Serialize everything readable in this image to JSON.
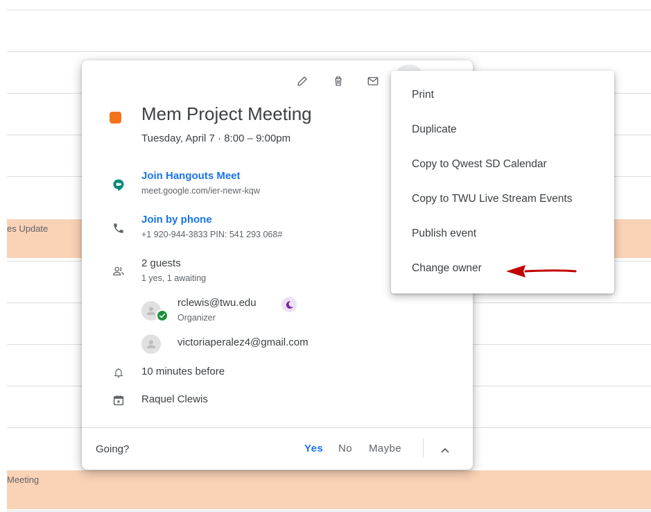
{
  "background": {
    "events": [
      {
        "label": "es Update"
      },
      {
        "label": "Meeting"
      }
    ]
  },
  "event": {
    "color": "#f4711c",
    "title": "Mem Project Meeting",
    "datetime": "Tuesday, April 7  ·  8:00 – 9:00pm",
    "hangouts": {
      "link_label": "Join Hangouts Meet",
      "url": "meet.google.com/ier-newr-kqw"
    },
    "phone": {
      "link_label": "Join by phone",
      "details": "+1 920-944-3833 PIN: 541 293 068#"
    },
    "guests": {
      "count_label": "2 guests",
      "status": "1 yes, 1 awaiting",
      "list": [
        {
          "email": "rclewis@twu.edu",
          "role": "Organizer"
        },
        {
          "email": "victoriaperalez4@gmail.com"
        }
      ]
    },
    "reminder": "10 minutes before",
    "calendar_owner": "Raquel Clewis"
  },
  "footer": {
    "going_label": "Going?",
    "yes": "Yes",
    "no": "No",
    "maybe": "Maybe"
  },
  "menu": {
    "items": [
      {
        "label": "Print"
      },
      {
        "label": "Duplicate"
      },
      {
        "label": "Copy to Qwest SD Calendar"
      },
      {
        "label": "Copy to TWU Live Stream Events"
      },
      {
        "label": "Publish event"
      },
      {
        "label": "Change owner"
      }
    ]
  },
  "colors": {
    "accent": "#1a73e8",
    "event_bg": "#fad2b6",
    "arrow": "#c00000",
    "organizer_check": "#1e8e3e",
    "moon": "#7b1fa2"
  }
}
